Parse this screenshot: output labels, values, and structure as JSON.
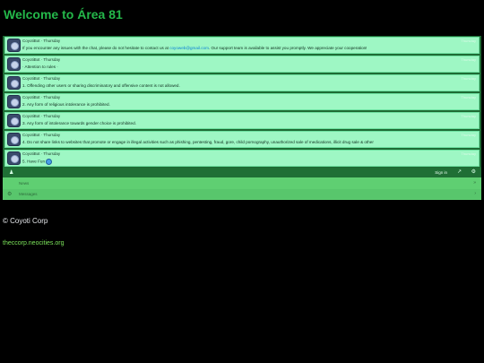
{
  "page": {
    "title": "Welcome to Área 81"
  },
  "chat": {
    "messages": [
      {
        "author": "CoyotiBot · Thursday",
        "text_before": "If you encounter any issues with the chat, please do not hesitate to contact us at ",
        "link": "coyoweb@gmail.com",
        "text_after": ". Our support team is available to assist you promptly. We appreciate your cooperation!",
        "time": "Thursday"
      },
      {
        "author": "CoyotiBot · Thursday",
        "text": "· Attention to rules ·",
        "time": "Thursday"
      },
      {
        "author": "CoyotiBot · Thursday",
        "text": "1. Offending other users or sharing discriminatory and offensive content is not allowed.",
        "time": "Thursday"
      },
      {
        "author": "CoyotiBot · Thursday",
        "text": "2. Any form of religious intolerance is prohibited.",
        "time": "Thursday"
      },
      {
        "author": "CoyotiBot · Thursday",
        "text": "3. Any form of intolerance towards gender choice is prohibited.",
        "time": "Thursday"
      },
      {
        "author": "CoyotiBot · Thursday",
        "text": "4. Do not share links to websites that promote or engage in illegal activities such as phishing, pentesting, fraud, gore, child pornography, unauthorized sale of medications, illicit drug sale & other",
        "time": "Thursday"
      },
      {
        "author": "CoyotiBot · Thursday",
        "text": "5. Have Fun",
        "time": "Thursday"
      }
    ]
  },
  "toolbar": {
    "signin_label": "Sign in",
    "user_icon": "user-icon",
    "external_icon": "external-link-icon",
    "settings_icon": "gear-icon"
  },
  "panel": {
    "news_label": "News",
    "messages_label": "Messages"
  },
  "footer": {
    "copyright": "© Coyoti Corp",
    "site": "theccorp.neocities.org"
  }
}
